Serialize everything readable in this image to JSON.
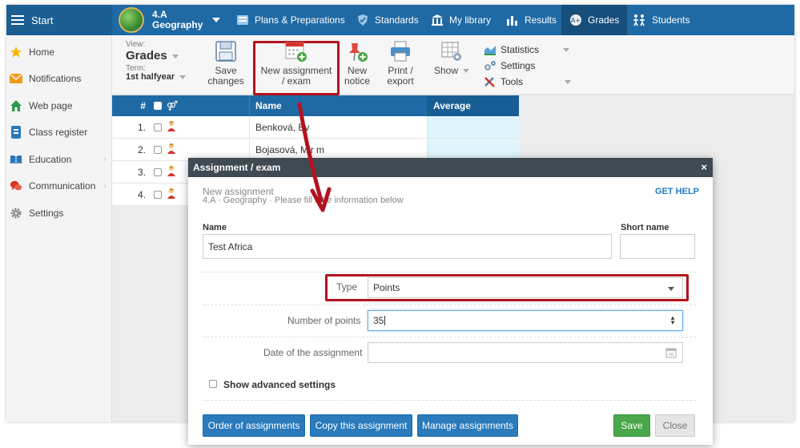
{
  "topbar": {
    "start_label": "Start",
    "class_name": "4.A",
    "subject": "Geography",
    "nav": [
      {
        "label": "Plans & Preparations",
        "icon": "book-icon"
      },
      {
        "label": "Standards",
        "icon": "shield-icon"
      },
      {
        "label": "My library",
        "icon": "library-icon"
      },
      {
        "label": "Results",
        "icon": "bar-chart-icon"
      },
      {
        "label": "Grades",
        "icon": "grades-icon",
        "active": true
      },
      {
        "label": "Students",
        "icon": "students-icon"
      }
    ]
  },
  "sidebar": {
    "items": [
      {
        "label": "Home",
        "icon": "star-icon"
      },
      {
        "label": "Notifications",
        "icon": "envelope-icon"
      },
      {
        "label": "Web page",
        "icon": "house-icon"
      },
      {
        "label": "Class register",
        "icon": "register-icon"
      },
      {
        "label": "Education",
        "icon": "open-book-icon",
        "chevron": "›"
      },
      {
        "label": "Communication",
        "icon": "chat-icon",
        "chevron": "›"
      },
      {
        "label": "Settings",
        "icon": "gear-icon"
      }
    ]
  },
  "ribbon": {
    "view_label": "View:",
    "view_value": "Grades",
    "term_label": "Term:",
    "term_value": "1st halfyear",
    "buttons": {
      "save": {
        "line1": "Save",
        "line2": "changes"
      },
      "new_assignment": {
        "line1": "New assignment",
        "line2": "/ exam"
      },
      "new_notice": {
        "line1": "New",
        "line2": "notice"
      },
      "print": {
        "line1": "Print /",
        "line2": "export"
      },
      "show": "Show"
    },
    "list": {
      "statistics": "Statistics",
      "settings": "Settings",
      "tools": "Tools"
    }
  },
  "grid": {
    "headers": {
      "num": "#",
      "name": "Name",
      "average": "Average"
    },
    "rows": [
      {
        "num": "1.",
        "name": "Benková, Ev"
      },
      {
        "num": "2.",
        "name": "Bojasová, Mir  m"
      },
      {
        "num": "3.",
        "name": ""
      },
      {
        "num": "4.",
        "name": ""
      }
    ]
  },
  "dialog": {
    "title": "Assignment / exam",
    "close": "×",
    "heading": "New assignment",
    "subheading": "4.A · Geography · Please fill    t the information below",
    "help": "GET HELP",
    "name_label": "Name",
    "name_value": "Test Africa",
    "short_name_label": "Short name",
    "short_name_value": "",
    "type_label": "Type",
    "type_value": "Points",
    "points_label": "Number of points",
    "points_value": "35",
    "date_label": "Date of the assignment",
    "date_value": "",
    "advanced_label": "Show advanced settings",
    "buttons": {
      "order": "Order of assignments",
      "copy": "Copy this assignment",
      "manage": "Manage assignments",
      "save": "Save",
      "close": "Close"
    }
  },
  "colors": {
    "primary": "#1f6aa5",
    "highlight": "#b3121f",
    "save_green": "#48a84a",
    "help_link": "#1f7cc8"
  }
}
